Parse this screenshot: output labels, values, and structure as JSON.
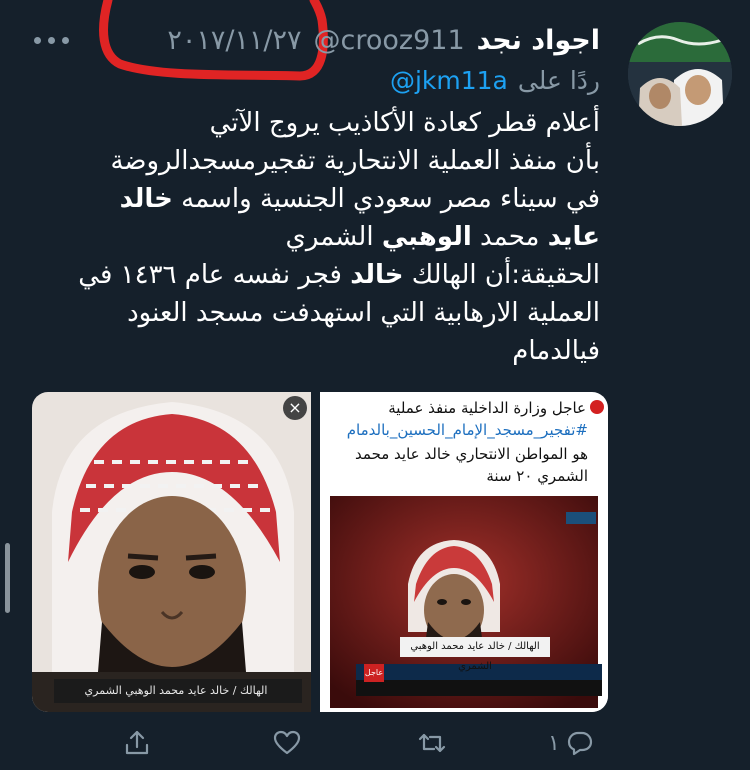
{
  "tweet": {
    "display_name": "اجواد نجد",
    "handle": "@crooz911",
    "date": "٢٠١٧/١١/٢٧",
    "reply_prefix": "ردًا على",
    "reply_handle": "@jkm11a",
    "body": {
      "line1": "أعلام قطر كعادة الأكاذيب يروج الآتي",
      "line2": "بأن منفذ العملية الانتحارية تفجيرمسجدالروضة",
      "line3_pre": "في سيناء مصر سعودي الجنسية واسمه ",
      "line3_bold": "خالد",
      "line4_bold": "عايد",
      "line4_post": " محمد ",
      "line4_bold2": "الوهبي",
      "line4_end": " الشمري",
      "line5_pre": "الحقيقة:أن الهالك ",
      "line5_bold": "خالد",
      "line5_post": " فجر نفسه عام ١٤٣٦ في",
      "line6": "العملية الارهابية التي استهدفت مسجد العنود",
      "line7": "فيالدمام"
    },
    "media": {
      "left_caption": "الهالك / خالد عايد محمد الوهبي الشمري",
      "close_symbol": "×",
      "news_line1": "عاجل وزارة الداخلية منفذ عملية",
      "news_line2": "#تفجير_مسجد_الإمام_الحسين_بالدمام",
      "news_line3": "هو المواطن الانتحاري خالد عايد محمد",
      "news_line4": "الشمري ٢٠ سنة",
      "tv_caption": "الهالك / خالد عايد محمد الوهبي الشمري",
      "tv_tag": "عاجل"
    },
    "actions": {
      "reply_count": "١",
      "retweet_count": "",
      "like_count": ""
    },
    "colors": {
      "background": "#15202b",
      "muted": "#8899a6",
      "link": "#1da1f2",
      "annotation": "#e02424"
    }
  }
}
